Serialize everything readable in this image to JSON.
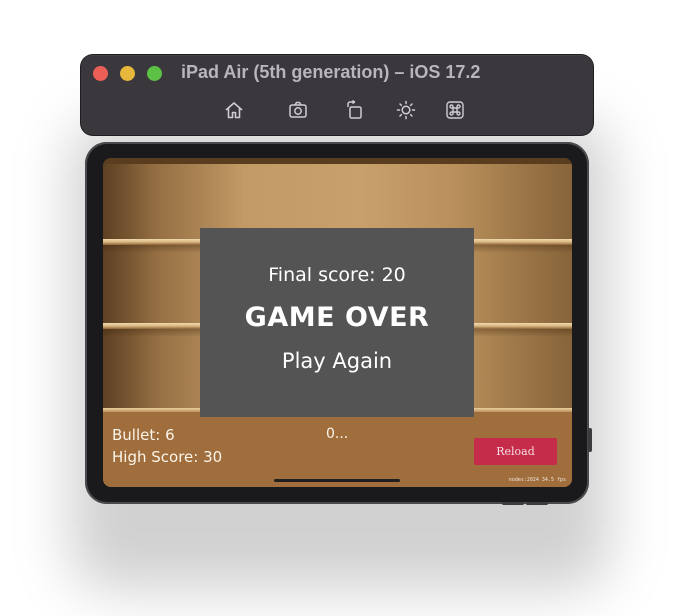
{
  "window": {
    "title": "iPad Air (5th generation) – iOS 17.2"
  },
  "toolbar": {
    "icons": [
      "home-icon",
      "screenshot-icon",
      "rotate-icon",
      "appearance-icon",
      "command-icon"
    ]
  },
  "game": {
    "hud": {
      "bullet": "Bullet: 6",
      "high_score": "High Score: 30",
      "status": "0...",
      "reload_label": "Reload",
      "perf": "nodes:2024   34.5 fps"
    },
    "dialog": {
      "final_score": "Final score: 20",
      "game_over": "GAME OVER",
      "play_again": "Play Again"
    }
  },
  "colors": {
    "titlebar": "#3a383c",
    "dialog_bg": "#545454",
    "reload_button": "#c52c49",
    "floor": "#a06d3c"
  }
}
